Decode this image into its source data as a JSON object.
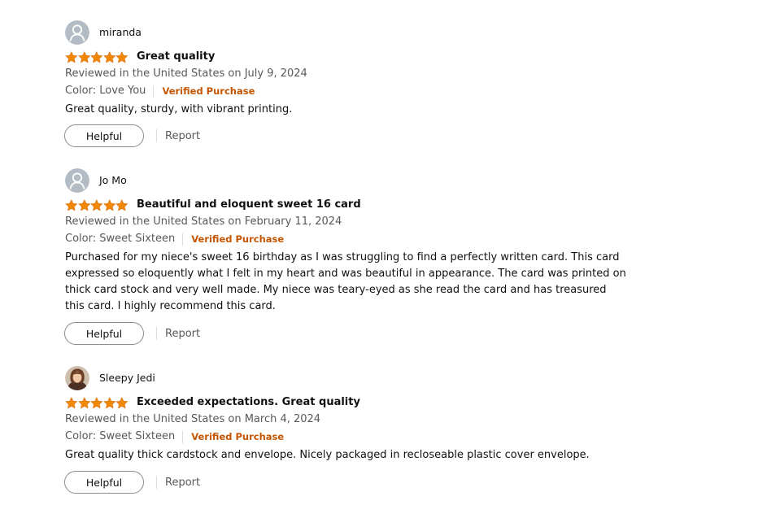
{
  "colors": {
    "star": "#f08804",
    "verified": "#c45500",
    "secondary_text": "#565959",
    "primary_text": "#0f1111",
    "button_border": "#888c8c"
  },
  "reviews": [
    {
      "reviewer": "miranda",
      "avatar": "default-avatar-icon",
      "rating": 5,
      "title": "Great quality",
      "date": "Reviewed in the United States on July 9, 2024",
      "variant": "Color: Love You",
      "verified": "Verified Purchase",
      "body": "Great quality, sturdy, with vibrant printing.",
      "helpful_label": "Helpful",
      "report_label": "Report"
    },
    {
      "reviewer": "Jo Mo",
      "avatar": "default-avatar-icon",
      "rating": 5,
      "title": "Beautiful and eloquent sweet 16 card",
      "date": "Reviewed in the United States on February 11, 2024",
      "variant": "Color: Sweet Sixteen",
      "verified": "Verified Purchase",
      "body": "Purchased for my niece's sweet 16 birthday as I was struggling to find a perfectly written card. This card expressed so eloquently what I felt in my heart and was beautiful in appearance. The card was printed on thick card stock and very well made. My niece was teary-eyed as she read the card and has treasured this card. I highly recommend this card.",
      "helpful_label": "Helpful",
      "report_label": "Report"
    },
    {
      "reviewer": "Sleepy Jedi",
      "avatar": "profile-photo",
      "rating": 5,
      "title": "Exceeded expectations. Great quality",
      "date": "Reviewed in the United States on March 4, 2024",
      "variant": "Color: Sweet Sixteen",
      "verified": "Verified Purchase",
      "body": "Great quality thick cardstock and envelope. Nicely packaged in recloseable plastic cover envelope.",
      "helpful_label": "Helpful",
      "report_label": "Report"
    }
  ]
}
